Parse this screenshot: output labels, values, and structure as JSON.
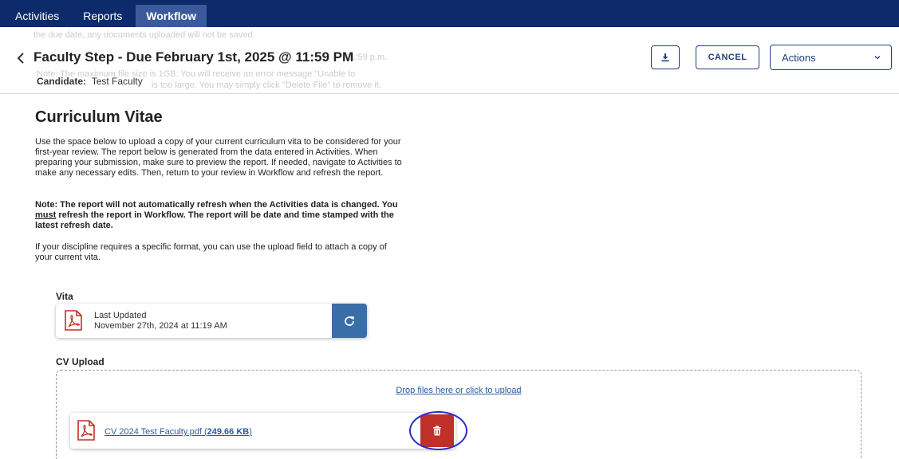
{
  "nav": {
    "tabs": [
      {
        "label": "Activities"
      },
      {
        "label": "Reports"
      },
      {
        "label": "Workflow"
      }
    ]
  },
  "header": {
    "title": "Faculty Step - Due February 1st, 2025 @ 11:59 PM",
    "candidate_label": "Candidate:",
    "candidate_value": "Test Faculty",
    "download_icon": "download-icon",
    "cancel_label": "CANCEL",
    "actions_label": "Actions",
    "ghost_lines": [
      "the due date, any documents uploaded will not be saved.",
      "11:59 p.m.",
      "Note: The maximum file size is 1GB. You will receive an error message \"Unable to",
      "is too large. You may simply click \"Delete File\" to remove it."
    ]
  },
  "main": {
    "section_title": "Curriculum Vitae",
    "paragraph1": "Use the space below to upload a copy of your current curriculum vita to be considered for your first-year review. The report below is generated from the data entered in Activities. When preparing your submission, make sure to preview the report. If needed, navigate to Activities to make any necessary edits. Then, return to your review in Workflow and refresh the report.",
    "note_part1": "Note: The report will not automatically refresh when the Activities data is changed. You ",
    "note_must": "must",
    "note_part2": " refresh the report in Workflow. The report will be date and time stamped with the latest refresh date.",
    "paragraph3": "If your discipline requires a specific format, you can use the upload field to attach a copy of your current vita.",
    "vita": {
      "label": "Vita",
      "last_updated_label": "Last Updated",
      "last_updated_value": "November 27th, 2024 at 11:19 AM"
    },
    "cv_upload": {
      "label": "CV Upload",
      "drop_text": "Drop files here or click to upload",
      "file_name": "CV 2024 Test Faculty.pdf",
      "file_size": "249.66 KB"
    }
  },
  "colors": {
    "nav_bg": "#0d2a6b",
    "accent": "#1f3f7a",
    "refresh_bg": "#3a6ea8",
    "delete_bg": "#c0302a",
    "pdf_red": "#c0302a",
    "highlight_ring": "#2b2bd0"
  }
}
